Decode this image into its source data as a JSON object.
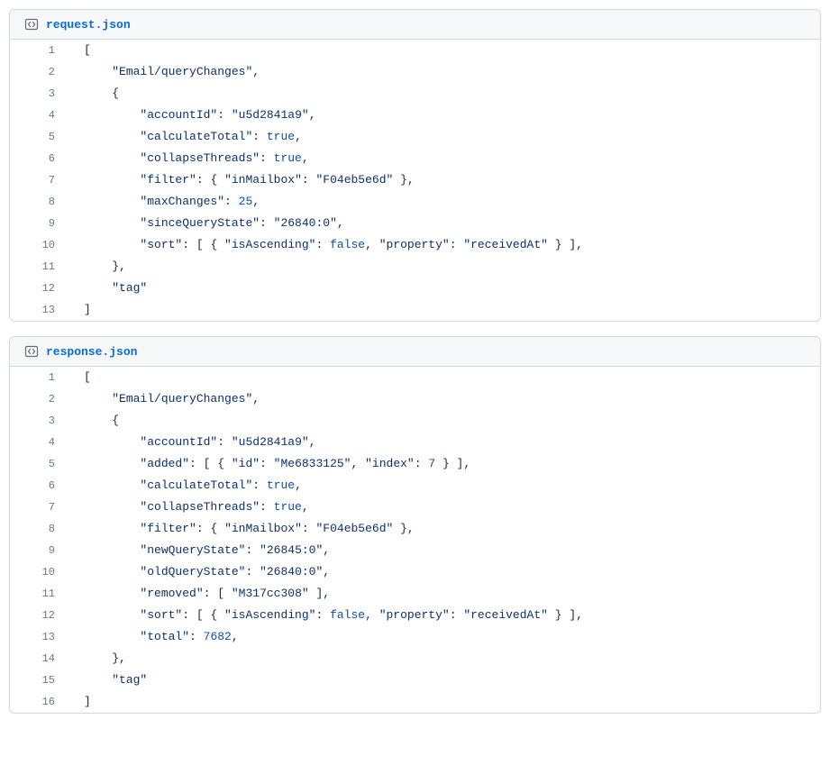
{
  "blocks": [
    {
      "filename": "request.json",
      "lines": [
        [
          {
            "t": "[",
            "c": "p"
          }
        ],
        [
          {
            "t": "    ",
            "c": "p"
          },
          {
            "t": "\"Email/queryChanges\"",
            "c": "s"
          },
          {
            "t": ",",
            "c": "p"
          }
        ],
        [
          {
            "t": "    {",
            "c": "p"
          }
        ],
        [
          {
            "t": "        ",
            "c": "p"
          },
          {
            "t": "\"accountId\"",
            "c": "k"
          },
          {
            "t": ": ",
            "c": "p"
          },
          {
            "t": "\"u5d2841a9\"",
            "c": "s"
          },
          {
            "t": ",",
            "c": "p"
          }
        ],
        [
          {
            "t": "        ",
            "c": "p"
          },
          {
            "t": "\"calculateTotal\"",
            "c": "k"
          },
          {
            "t": ": ",
            "c": "p"
          },
          {
            "t": "true",
            "c": "b"
          },
          {
            "t": ",",
            "c": "p"
          }
        ],
        [
          {
            "t": "        ",
            "c": "p"
          },
          {
            "t": "\"collapseThreads\"",
            "c": "k"
          },
          {
            "t": ": ",
            "c": "p"
          },
          {
            "t": "true",
            "c": "b"
          },
          {
            "t": ",",
            "c": "p"
          }
        ],
        [
          {
            "t": "        ",
            "c": "p"
          },
          {
            "t": "\"filter\"",
            "c": "k"
          },
          {
            "t": ": { ",
            "c": "p"
          },
          {
            "t": "\"inMailbox\"",
            "c": "k"
          },
          {
            "t": ": ",
            "c": "p"
          },
          {
            "t": "\"F04eb5e6d\"",
            "c": "s"
          },
          {
            "t": " },",
            "c": "p"
          }
        ],
        [
          {
            "t": "        ",
            "c": "p"
          },
          {
            "t": "\"maxChanges\"",
            "c": "k"
          },
          {
            "t": ": ",
            "c": "p"
          },
          {
            "t": "25",
            "c": "n"
          },
          {
            "t": ",",
            "c": "p"
          }
        ],
        [
          {
            "t": "        ",
            "c": "p"
          },
          {
            "t": "\"sinceQueryState\"",
            "c": "k"
          },
          {
            "t": ": ",
            "c": "p"
          },
          {
            "t": "\"26840:0\"",
            "c": "s"
          },
          {
            "t": ",",
            "c": "p"
          }
        ],
        [
          {
            "t": "        ",
            "c": "p"
          },
          {
            "t": "\"sort\"",
            "c": "k"
          },
          {
            "t": ": [ { ",
            "c": "p"
          },
          {
            "t": "\"isAscending\"",
            "c": "k"
          },
          {
            "t": ": ",
            "c": "p"
          },
          {
            "t": "false",
            "c": "b"
          },
          {
            "t": ", ",
            "c": "p"
          },
          {
            "t": "\"property\"",
            "c": "k"
          },
          {
            "t": ": ",
            "c": "p"
          },
          {
            "t": "\"receivedAt\"",
            "c": "s"
          },
          {
            "t": " } ],",
            "c": "p"
          }
        ],
        [
          {
            "t": "    },",
            "c": "p"
          }
        ],
        [
          {
            "t": "    ",
            "c": "p"
          },
          {
            "t": "\"tag\"",
            "c": "s"
          }
        ],
        [
          {
            "t": "]",
            "c": "p"
          }
        ]
      ]
    },
    {
      "filename": "response.json",
      "lines": [
        [
          {
            "t": "[",
            "c": "p"
          }
        ],
        [
          {
            "t": "    ",
            "c": "p"
          },
          {
            "t": "\"Email/queryChanges\"",
            "c": "s"
          },
          {
            "t": ",",
            "c": "p"
          }
        ],
        [
          {
            "t": "    {",
            "c": "p"
          }
        ],
        [
          {
            "t": "        ",
            "c": "p"
          },
          {
            "t": "\"accountId\"",
            "c": "k"
          },
          {
            "t": ": ",
            "c": "p"
          },
          {
            "t": "\"u5d2841a9\"",
            "c": "s"
          },
          {
            "t": ",",
            "c": "p"
          }
        ],
        [
          {
            "t": "        ",
            "c": "p"
          },
          {
            "t": "\"added\"",
            "c": "k"
          },
          {
            "t": ": [ { ",
            "c": "p"
          },
          {
            "t": "\"id\"",
            "c": "k"
          },
          {
            "t": ": ",
            "c": "p"
          },
          {
            "t": "\"Me6833125\"",
            "c": "s"
          },
          {
            "t": ", ",
            "c": "p"
          },
          {
            "t": "\"index\"",
            "c": "k"
          },
          {
            "t": ": ",
            "c": "p"
          },
          {
            "t": "7",
            "c": "n"
          },
          {
            "t": " } ],",
            "c": "p"
          }
        ],
        [
          {
            "t": "        ",
            "c": "p"
          },
          {
            "t": "\"calculateTotal\"",
            "c": "k"
          },
          {
            "t": ": ",
            "c": "p"
          },
          {
            "t": "true",
            "c": "b"
          },
          {
            "t": ",",
            "c": "p"
          }
        ],
        [
          {
            "t": "        ",
            "c": "p"
          },
          {
            "t": "\"collapseThreads\"",
            "c": "k"
          },
          {
            "t": ": ",
            "c": "p"
          },
          {
            "t": "true",
            "c": "b"
          },
          {
            "t": ",",
            "c": "p"
          }
        ],
        [
          {
            "t": "        ",
            "c": "p"
          },
          {
            "t": "\"filter\"",
            "c": "k"
          },
          {
            "t": ": { ",
            "c": "p"
          },
          {
            "t": "\"inMailbox\"",
            "c": "k"
          },
          {
            "t": ": ",
            "c": "p"
          },
          {
            "t": "\"F04eb5e6d\"",
            "c": "s"
          },
          {
            "t": " },",
            "c": "p"
          }
        ],
        [
          {
            "t": "        ",
            "c": "p"
          },
          {
            "t": "\"newQueryState\"",
            "c": "k"
          },
          {
            "t": ": ",
            "c": "p"
          },
          {
            "t": "\"26845:0\"",
            "c": "s"
          },
          {
            "t": ",",
            "c": "p"
          }
        ],
        [
          {
            "t": "        ",
            "c": "p"
          },
          {
            "t": "\"oldQueryState\"",
            "c": "k"
          },
          {
            "t": ": ",
            "c": "p"
          },
          {
            "t": "\"26840:0\"",
            "c": "s"
          },
          {
            "t": ",",
            "c": "p"
          }
        ],
        [
          {
            "t": "        ",
            "c": "p"
          },
          {
            "t": "\"removed\"",
            "c": "k"
          },
          {
            "t": ": [ ",
            "c": "p"
          },
          {
            "t": "\"M317cc308\"",
            "c": "s"
          },
          {
            "t": " ],",
            "c": "p"
          }
        ],
        [
          {
            "t": "        ",
            "c": "p"
          },
          {
            "t": "\"sort\"",
            "c": "k"
          },
          {
            "t": ": [ { ",
            "c": "p"
          },
          {
            "t": "\"isAscending\"",
            "c": "k"
          },
          {
            "t": ": ",
            "c": "p"
          },
          {
            "t": "false",
            "c": "b"
          },
          {
            "t": ", ",
            "c": "p"
          },
          {
            "t": "\"property\"",
            "c": "k"
          },
          {
            "t": ": ",
            "c": "p"
          },
          {
            "t": "\"receivedAt\"",
            "c": "s"
          },
          {
            "t": " } ],",
            "c": "p"
          }
        ],
        [
          {
            "t": "        ",
            "c": "p"
          },
          {
            "t": "\"total\"",
            "c": "k"
          },
          {
            "t": ": ",
            "c": "p"
          },
          {
            "t": "7682",
            "c": "n"
          },
          {
            "t": ",",
            "c": "p"
          }
        ],
        [
          {
            "t": "    },",
            "c": "p"
          }
        ],
        [
          {
            "t": "    ",
            "c": "p"
          },
          {
            "t": "\"tag\"",
            "c": "s"
          }
        ],
        [
          {
            "t": "]",
            "c": "p"
          }
        ]
      ]
    }
  ]
}
